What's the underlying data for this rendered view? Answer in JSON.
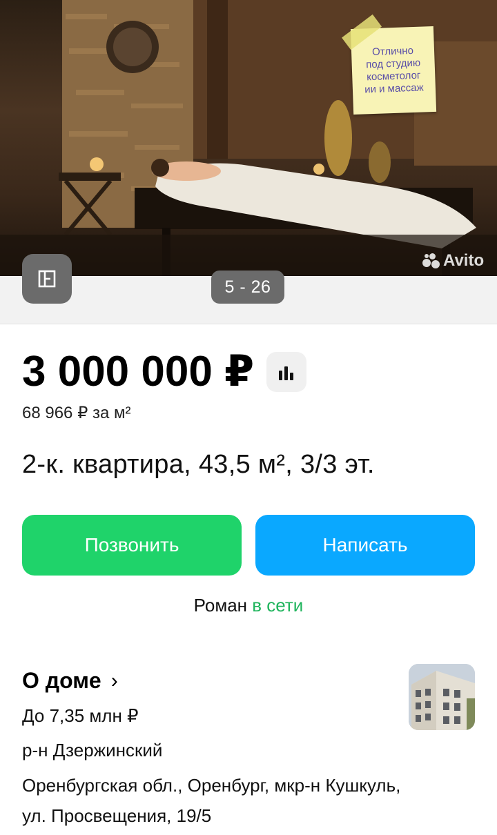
{
  "gallery": {
    "sticker_text": "Отлично\nпод студию\nкосметолог\nии и массаж",
    "watermark": "Avito",
    "counter": "5 - 26",
    "plan_icon": "floor-plan-icon"
  },
  "listing": {
    "price": "3 000 000 ₽",
    "price_per_m2": "68 966 ₽ за м²",
    "title": "2-к. квартира, 43,5 м², 3/3 эт.",
    "stats_icon": "bar-chart-icon"
  },
  "actions": {
    "call_label": "Позвонить",
    "write_label": "Написать"
  },
  "seller": {
    "name": "Роман",
    "status": "в сети"
  },
  "house": {
    "title": "О доме",
    "chevron": "›",
    "price_range": "До 7,35 млн ₽",
    "district": "р-н Дзержинский",
    "address": "Оренбургская обл., Оренбург, мкр-н Кушкуль, ул. Просвещения, 19/5"
  },
  "colors": {
    "call_button": "#1fd36a",
    "write_button": "#0aa8ff",
    "online": "#1fb45c"
  }
}
